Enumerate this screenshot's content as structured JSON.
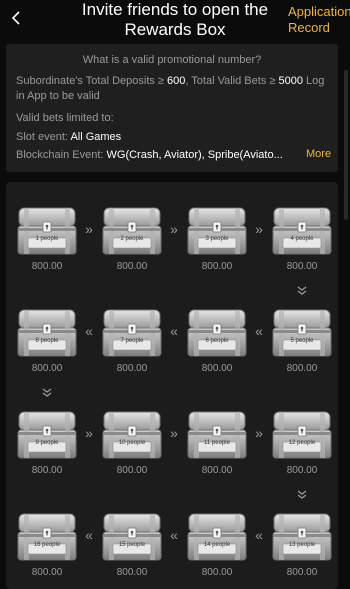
{
  "header": {
    "back_icon": "chevron-left-icon",
    "title": "Invite friends to open the Rewards Box",
    "record_label": "Application Record"
  },
  "info": {
    "question": "What is a valid promotional number?",
    "requirement_prefix": "Subordinate's Total Deposits ≥ ",
    "deposit_value": "600",
    "requirement_mid": ",  Total Valid Bets ≥ ",
    "bet_value": "5000",
    "requirement_suffix": " Log in App to be valid",
    "limited_label": "Valid bets limited to:",
    "slot_label": "Slot event: ",
    "slot_value": "All Games",
    "blockchain_label": "Blockchain Event: ",
    "blockchain_value": "WG(Crash, Aviator), Spribe(Aviato...",
    "more_label": "More"
  },
  "boxes": [
    {
      "label": "1 people",
      "amount": "800.00"
    },
    {
      "label": "2 people",
      "amount": "800.00"
    },
    {
      "label": "3 people",
      "amount": "800.00"
    },
    {
      "label": "4 people",
      "amount": "800.00"
    },
    {
      "label": "5 people",
      "amount": "800.00"
    },
    {
      "label": "6 people",
      "amount": "800.00"
    },
    {
      "label": "7 people",
      "amount": "800.00"
    },
    {
      "label": "8 people",
      "amount": "800.00"
    },
    {
      "label": "9 people",
      "amount": "800.00"
    },
    {
      "label": "10 people",
      "amount": "800.00"
    },
    {
      "label": "11 people",
      "amount": "800.00"
    },
    {
      "label": "12 people",
      "amount": "800.00"
    },
    {
      "label": "13 people",
      "amount": "800.00"
    },
    {
      "label": "14 people",
      "amount": "800.00"
    },
    {
      "label": "15 people",
      "amount": "800.00"
    },
    {
      "label": "16 people",
      "amount": "800.00"
    }
  ],
  "colors": {
    "accent": "#f1b53b",
    "background": "#0b0b0b",
    "panel": "#1f1f1f"
  }
}
